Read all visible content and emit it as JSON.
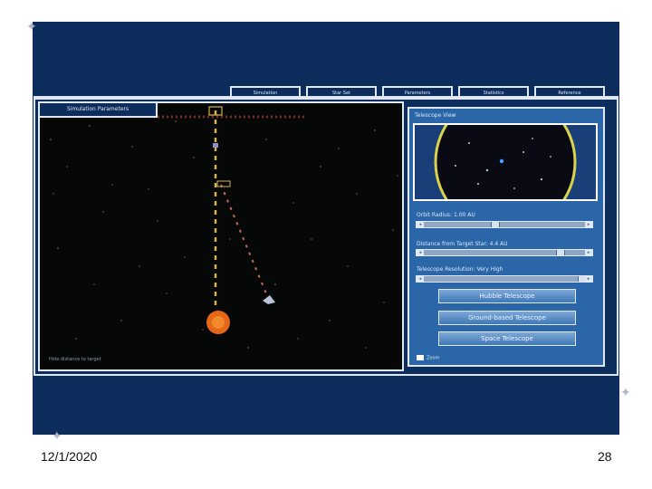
{
  "app": {
    "tabs": [
      {
        "label": "Simulation"
      },
      {
        "label": "Star Set"
      },
      {
        "label": "Parameters"
      },
      {
        "label": "Statistics"
      },
      {
        "label": "Reference"
      }
    ],
    "sim": {
      "tab_label": "Simulation Parameters",
      "footer": "Hide distance to target"
    },
    "panel": {
      "title": "Telescope View",
      "orbit_label": "Orbit Radius: 1.00 AU",
      "distance_label": "Distance from Target Star: 4.4 AU",
      "resolution_label": "Telescope Resolution: Very High",
      "buttons": [
        "Hubble Telescope",
        "Ground-based Telescope",
        "Space Telescope"
      ],
      "checkbox_label": "Zoom"
    }
  },
  "slide_footer": {
    "date": "12/1/2020",
    "page_number": "28"
  },
  "colors": {
    "slide_bg": "#0d2d5c",
    "panel_bg": "#2a66a8",
    "frame": "#dfe8f3",
    "sun": "#e7661a"
  }
}
